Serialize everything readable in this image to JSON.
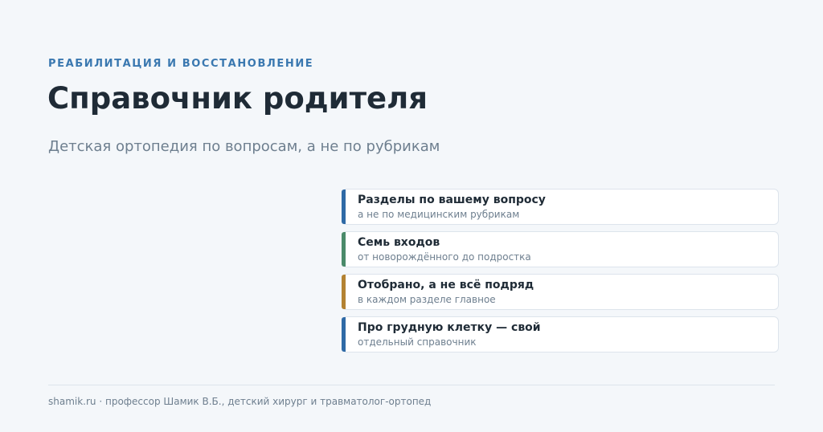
{
  "header": {
    "eyebrow": "РЕАБИЛИТАЦИЯ И ВОССТАНОВЛЕНИЕ",
    "title": "Справочник родителя",
    "subtitle": "Детская ортопедия по вопросам, а не по рубрикам"
  },
  "colors": {
    "accent": "#3a78b0",
    "bar_blue": "#2f6aa6",
    "bar_green": "#4a8a6a",
    "bar_gold": "#b38232"
  },
  "features": [
    {
      "title": "Разделы по вашему вопросу",
      "subtitle": "а не по медицинским рубрикам",
      "color": "#2f6aa6"
    },
    {
      "title": "Семь входов",
      "subtitle": "от новорождённого до подростка",
      "color": "#4a8a6a"
    },
    {
      "title": "Отобрано, а не всё подряд",
      "subtitle": "в каждом разделе главное",
      "color": "#b38232"
    },
    {
      "title": "Про грудную клетку — свой",
      "subtitle": "отдельный справочник",
      "color": "#2f6aa6"
    }
  ],
  "footer": {
    "text": "shamik.ru · профессор Шамик В.Б., детский хирург и травматолог-ортопед"
  }
}
